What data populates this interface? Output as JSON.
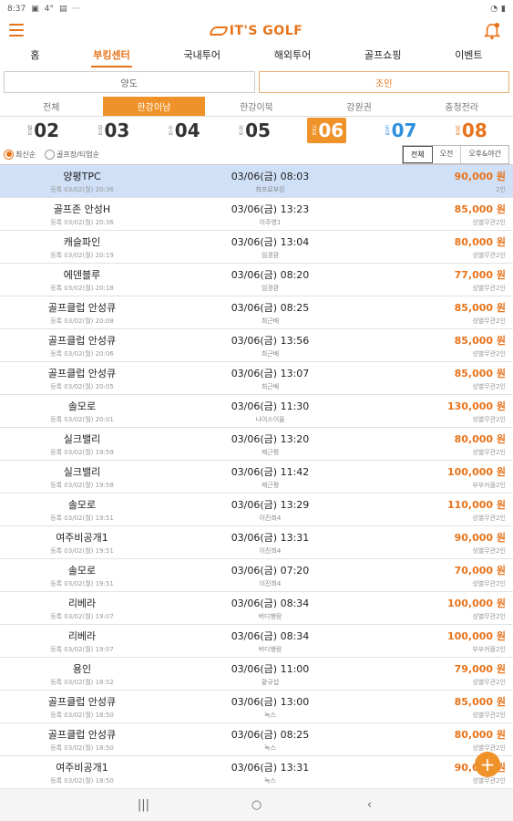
{
  "status": {
    "time": "8:37",
    "temp": "4°",
    "more": "···"
  },
  "app": {
    "logo_text": "IT'S GOLF",
    "brand_color": "#e8731a"
  },
  "main_nav": [
    {
      "label": "홈"
    },
    {
      "label": "부킹센터"
    },
    {
      "label": "국내투어"
    },
    {
      "label": "해외투어"
    },
    {
      "label": "골프쇼핑"
    },
    {
      "label": "이벤트"
    }
  ],
  "mode_toggle": [
    {
      "label": "양도"
    },
    {
      "label": "조인"
    }
  ],
  "region_tabs": [
    {
      "label": "전체"
    },
    {
      "label": "한강이남"
    },
    {
      "label": "한강이북"
    },
    {
      "label": "강원권"
    },
    {
      "label": "충청전라"
    }
  ],
  "dates": [
    {
      "dow": "월요",
      "day": "02"
    },
    {
      "dow": "화요",
      "day": "03"
    },
    {
      "dow": "수요",
      "day": "04"
    },
    {
      "dow": "목요",
      "day": "05"
    },
    {
      "dow": "금요",
      "day": "06"
    },
    {
      "dow": "토요",
      "day": "07"
    },
    {
      "dow": "일요",
      "day": "08"
    }
  ],
  "sort_options": [
    {
      "label": "최신순"
    },
    {
      "label": "골프장/티업순"
    }
  ],
  "time_filters": [
    {
      "label": "전체"
    },
    {
      "label": "오전"
    },
    {
      "label": "오후&야간"
    }
  ],
  "listings": [
    {
      "course": "양평TPC",
      "registered": "등록 03/02(월) 20:36",
      "tee": "03/06(금) 08:03",
      "seller": "최프로부킹",
      "price": "90,000 원",
      "cond": "2인"
    },
    {
      "course": "골프존 안성H",
      "registered": "등록 03/02(월) 20:36",
      "tee": "03/06(금) 13:23",
      "seller": "이주영1",
      "price": "85,000 원",
      "cond": "성별무관2인"
    },
    {
      "course": "캐슬파인",
      "registered": "등록 03/02(월) 20:19",
      "tee": "03/06(금) 13:04",
      "seller": "임경환",
      "price": "80,000 원",
      "cond": "성별무관2인"
    },
    {
      "course": "에덴블루",
      "registered": "등록 03/02(월) 20:18",
      "tee": "03/06(금) 08:20",
      "seller": "임경환",
      "price": "77,000 원",
      "cond": "성별무관2인"
    },
    {
      "course": "골프클럽 안성큐",
      "registered": "등록 03/02(월) 20:08",
      "tee": "03/06(금) 08:25",
      "seller": "최근배",
      "price": "85,000 원",
      "cond": "성별무관2인"
    },
    {
      "course": "골프클럽 안성큐",
      "registered": "등록 03/02(월) 20:06",
      "tee": "03/06(금) 13:56",
      "seller": "최근배",
      "price": "85,000 원",
      "cond": "성별무관2인"
    },
    {
      "course": "골프클럽 안성큐",
      "registered": "등록 03/02(월) 20:05",
      "tee": "03/06(금) 13:07",
      "seller": "최근배",
      "price": "85,000 원",
      "cond": "성별무관2인"
    },
    {
      "course": "솔모로",
      "registered": "등록 03/02(월) 20:01",
      "tee": "03/06(금) 11:30",
      "seller": "나이스이올",
      "price": "130,000 원",
      "cond": "성별무관2인"
    },
    {
      "course": "실크밸리",
      "registered": "등록 03/02(월) 19:59",
      "tee": "03/06(금) 13:20",
      "seller": "제근평",
      "price": "80,000 원",
      "cond": "성별무관2인"
    },
    {
      "course": "실크밸리",
      "registered": "등록 03/02(월) 19:58",
      "tee": "03/06(금) 11:42",
      "seller": "제근평",
      "price": "100,000 원",
      "cond": "부부커플2인"
    },
    {
      "course": "솔모로",
      "registered": "등록 03/02(월) 19:51",
      "tee": "03/06(금) 13:29",
      "seller": "이진희4",
      "price": "110,000 원",
      "cond": "성별무관2인"
    },
    {
      "course": "여주비공개1",
      "registered": "등록 03/02(월) 19:51",
      "tee": "03/06(금) 13:31",
      "seller": "이진희4",
      "price": "90,000 원",
      "cond": "성별무관2인"
    },
    {
      "course": "솔모로",
      "registered": "등록 03/02(월) 19:51",
      "tee": "03/06(금) 07:20",
      "seller": "이진희4",
      "price": "70,000 원",
      "cond": "성별무관2인"
    },
    {
      "course": "리베라",
      "registered": "등록 03/02(월) 19:07",
      "tee": "03/06(금) 08:34",
      "seller": "버디행랑",
      "price": "100,000 원",
      "cond": "성별무관2인"
    },
    {
      "course": "리베라",
      "registered": "등록 03/02(월) 19:07",
      "tee": "03/06(금) 08:34",
      "seller": "버디행랑",
      "price": "100,000 원",
      "cond": "부부커플2인"
    },
    {
      "course": "용인",
      "registered": "등록 03/02(월) 18:52",
      "tee": "03/06(금) 11:00",
      "seller": "황규섭",
      "price": "79,000 원",
      "cond": "성별무관2인"
    },
    {
      "course": "골프클럽 안성큐",
      "registered": "등록 03/02(월) 18:50",
      "tee": "03/06(금) 13:00",
      "seller": "녹스",
      "price": "85,000 원",
      "cond": "성별무관2인"
    },
    {
      "course": "골프클럽 안성큐",
      "registered": "등록 03/02(월) 18:50",
      "tee": "03/06(금) 08:25",
      "seller": "녹스",
      "price": "80,000 원",
      "cond": "성별무관2인"
    },
    {
      "course": "여주비공개1",
      "registered": "등록 03/02(월) 18:50",
      "tee": "03/06(금) 13:31",
      "seller": "녹스",
      "price": "90,000 원",
      "cond": "성별무관2인"
    }
  ],
  "fab": {
    "label": "+"
  },
  "system_nav": {
    "recents": "|||",
    "home": "○",
    "back": "‹"
  }
}
